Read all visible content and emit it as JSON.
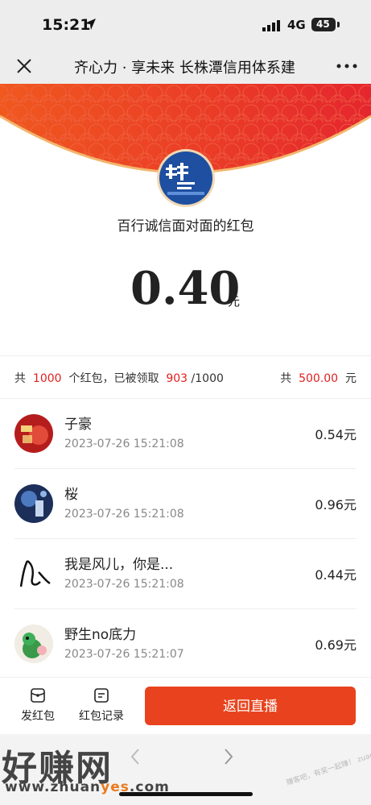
{
  "status": {
    "time": "15:21",
    "network": "4G",
    "battery": "45"
  },
  "nav": {
    "title": "齐心力 · 享未来 长株潭信用体系建"
  },
  "packet": {
    "sender": "百行诚信面对面的红包",
    "amount": "0.40",
    "unit": "元"
  },
  "summary": {
    "prefix": "共",
    "total_count": "1000",
    "mid": "个红包，已被领取",
    "claimed": "903",
    "of_total": "/1000",
    "total_prefix": "共",
    "total_amount": "500.00",
    "total_unit": "元"
  },
  "records": [
    {
      "name": "子豪",
      "time": "2023-07-26 15:21:08",
      "amount": "0.54元"
    },
    {
      "name": "桜",
      "time": "2023-07-26 15:21:08",
      "amount": "0.96元"
    },
    {
      "name": "我是风儿，你是...",
      "time": "2023-07-26 15:21:08",
      "amount": "0.44元"
    },
    {
      "name": "野生no底力",
      "time": "2023-07-26 15:21:07",
      "amount": "0.69元"
    }
  ],
  "bottom": {
    "send_label": "发红包",
    "records_label": "红包记录",
    "back_live_label": "返回直播"
  },
  "watermark": {
    "main": "好赚网",
    "url_a": "www.zhuan",
    "url_b": "yes",
    "url_c": ".com",
    "side": "赚客吧，有奖一起赚！ zuanke8.com"
  },
  "colors": {
    "accent": "#e8431e",
    "highlight": "#e02020",
    "banner": "#e8392a"
  }
}
